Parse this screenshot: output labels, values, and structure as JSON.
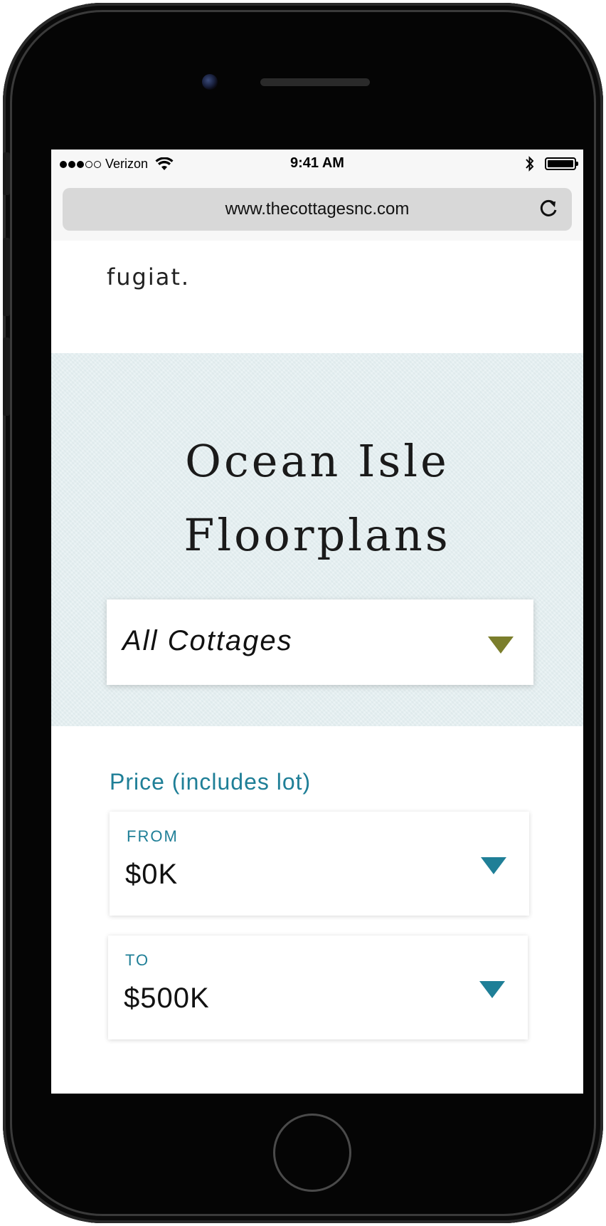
{
  "status_bar": {
    "carrier": "Verizon",
    "time": "9:41 AM",
    "wifi_icon": "wifi-icon",
    "bluetooth_icon": "bluetooth-icon",
    "battery_icon": "battery-icon"
  },
  "browser": {
    "url": "www.thecottagesnc.com",
    "reload_icon": "reload-icon"
  },
  "header": {
    "logo": "fugiat."
  },
  "hero": {
    "title_line1": "Ocean Isle",
    "title_line2": "Floorplans",
    "cottage_select": {
      "selected": "All Cottages"
    }
  },
  "filters": {
    "price_heading": "Price (includes lot)",
    "from": {
      "label": "FROM",
      "value": "$0K"
    },
    "to": {
      "label": "TO",
      "value": "$500K"
    }
  },
  "colors": {
    "accent_teal": "#1f7f97",
    "accent_olive": "#7b7e2c",
    "hero_bg": "#e4eff1"
  }
}
